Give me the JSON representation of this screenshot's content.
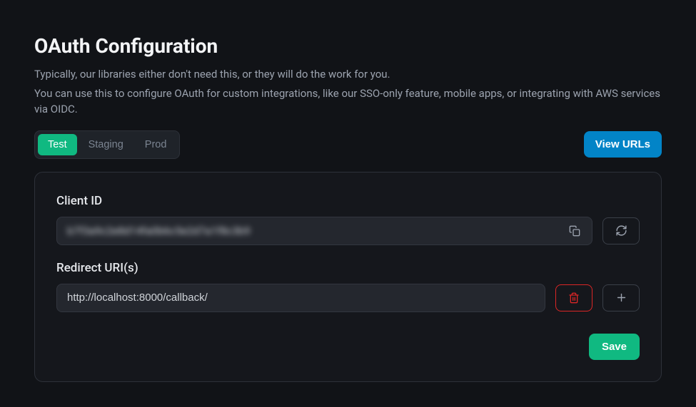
{
  "header": {
    "title": "OAuth Configuration",
    "description_line1": "Typically, our libraries either don't need this, or they will do the work for you.",
    "description_line2": "You can use this to configure OAuth for custom integrations, like our SSO-only feature, mobile apps, or integrating with AWS services via OIDC."
  },
  "tabs": {
    "items": [
      "Test",
      "Staging",
      "Prod"
    ],
    "active": "Test"
  },
  "toolbar": {
    "view_urls_label": "View URLs"
  },
  "config": {
    "client_id": {
      "label": "Client ID",
      "value": "b7f3a9c2e8d14fa0b6c5e2d7a1f8c3b9"
    },
    "redirect_uris": {
      "label": "Redirect URI(s)",
      "items": [
        "http://localhost:8000/callback/"
      ]
    },
    "save_label": "Save"
  }
}
